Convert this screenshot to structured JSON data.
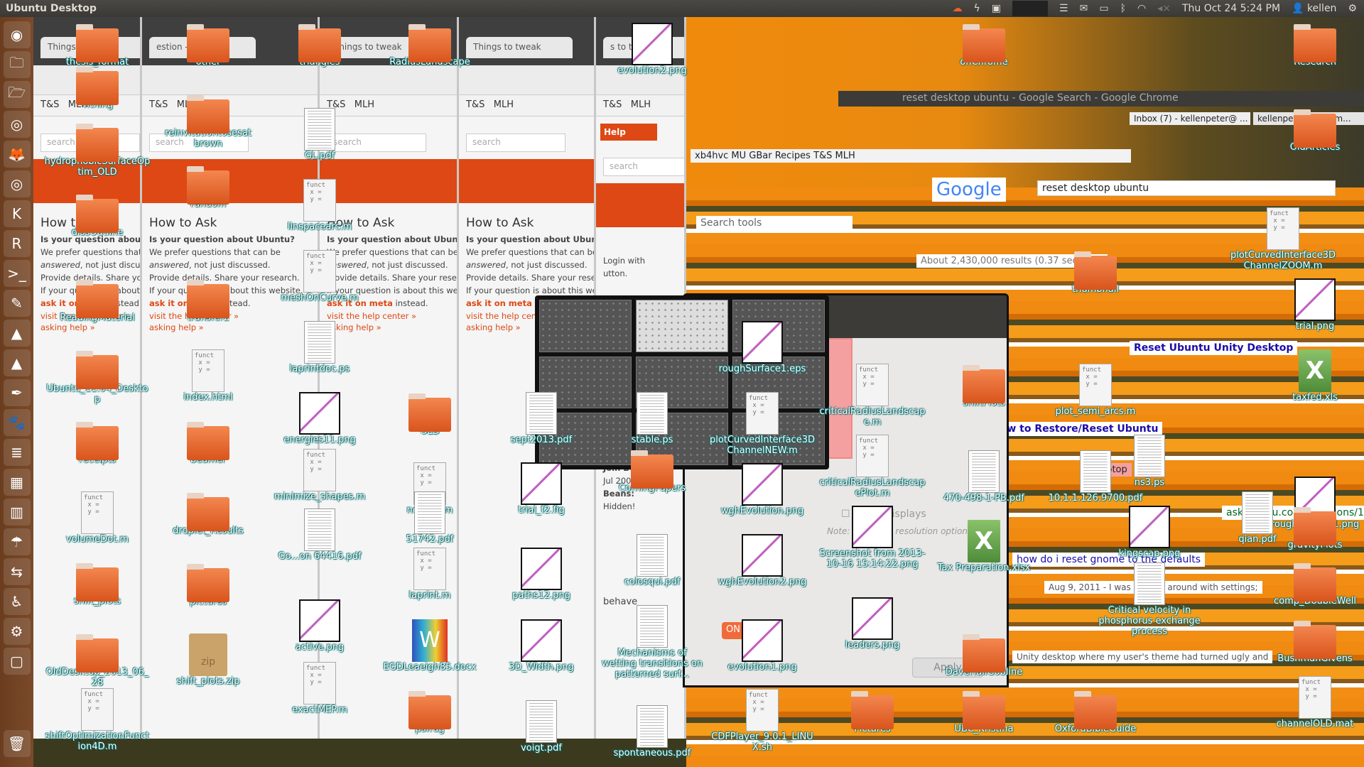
{
  "panel": {
    "title": "Ubuntu Desktop",
    "indicators": [
      "cloud-icon",
      "bolt-icon",
      "network-error-icon",
      "keyboard-menu-icon",
      "mail-icon",
      "battery-icon",
      "bluetooth-icon",
      "wifi-icon",
      "volume-muted-icon"
    ],
    "clock": "Thu Oct 24  5:24 PM",
    "user": "kellen",
    "power_icon": "gear-power-icon"
  },
  "launcher": {
    "items": [
      "ubuntu-dash-icon",
      "files-icon",
      "files-app-icon",
      "chrome-icon",
      "firefox-icon",
      "chromium-icon",
      "kde-icon",
      "jabref-icon",
      "terminal-icon",
      "text-editor-icon",
      "matlab-icon",
      "matlab-alt-icon",
      "inkscape-icon",
      "gimp-icon",
      "writer-icon",
      "calc-icon",
      "system-monitor-icon",
      "ubuntu-one-icon",
      "remote-desktop-icon",
      "accessibility-icon",
      "settings-icon",
      "workspace-switcher-icon",
      "trash-icon"
    ]
  },
  "browser": {
    "tabs": [
      "Things to tweak",
      "estion -",
      "Things to tweak",
      "Things to tweak",
      "s to twe"
    ],
    "bookmarks": [
      "T&S",
      "MLH"
    ],
    "search_placeholder": "search",
    "help_label": "Help",
    "help_link": "help",
    "heading": "How to Ask",
    "q1": "Is your question about Ubuntu?",
    "p1": "We prefer questions that can be",
    "p2a": "answered",
    "p2b": ", not just discussed.",
    "p3": "Provide details. Share your research.",
    "p4": "If your question is about this website,",
    "meta_link": "ask it on meta",
    "meta_tail": " instead.",
    "link_help": "visit the help center »",
    "link_asking": "asking help »",
    "login": "Login with",
    "button_tail": "utton.",
    "join": "Join Date",
    "join_val": "Jul 2009",
    "beans": "Beans:",
    "beans_val": "Hidden!",
    "behave": "behave"
  },
  "chrome": {
    "title": "reset desktop ubuntu - Google Search - Google Chrome",
    "tab_inbox": "Inbox (7) - kellenpeter@ ...",
    "tab_mail": "kellenpeterson@gm...",
    "bookmarks": "xb4hvc  MU  GBar  Recipes  T&S  MLH",
    "query": "reset desktop ubuntu",
    "search_tools": "Search tools",
    "results": "About 2,430,000 results (0.37 seconds)",
    "r1": "Reset Ubuntu Unity Desktop",
    "r2": "How to Restore/Reset Ubuntu",
    "r3": "askubuntu.com/questions/146",
    "r4": "how do i reset gnome to the defaults",
    "r5": "Aug 9, 2011 - I was playing around with settings;",
    "r6": "Unity desktop where my user's theme had turned ugly and",
    "laptop": "Laptop"
  },
  "settings_window": {
    "mirror": "Mirror displays",
    "note": "Note: may limit resolution options",
    "on": "ON",
    "apply": "Apply"
  },
  "desktop": {
    "icons": [
      {
        "label": "thesis_format",
        "type": "folder"
      },
      {
        "label": "Tithing",
        "type": "folder"
      },
      {
        "label": "hydrophobicSurfaceOptim_OLD",
        "type": "folder"
      },
      {
        "label": "dissOutline",
        "type": "folder"
      },
      {
        "label": "ReadingMaterial",
        "type": "folder"
      },
      {
        "label": "Ubuntu_11.04_Desktop",
        "type": "folder"
      },
      {
        "label": "receipts",
        "type": "folder"
      },
      {
        "label": "volumeDot.m",
        "type": "script"
      },
      {
        "label": "shift_plots",
        "type": "folder"
      },
      {
        "label": "OldDesktop_2013_06_28",
        "type": "folder"
      },
      {
        "label": "shiftOptimizationFunction4D.m",
        "type": "script"
      },
      {
        "label": "other",
        "type": "folder"
      },
      {
        "label": "reinvitationtosesat brown",
        "type": "folder"
      },
      {
        "label": "random",
        "type": "folder"
      },
      {
        "label": "transfer2",
        "type": "folder"
      },
      {
        "label": "index.html",
        "type": "script"
      },
      {
        "label": "beamer",
        "type": "folder"
      },
      {
        "label": "droplet_Results",
        "type": "folder"
      },
      {
        "label": "pictures",
        "type": "folder"
      },
      {
        "label": "shift_plots.zip",
        "type": "zip"
      },
      {
        "label": "triangles",
        "type": "folder"
      },
      {
        "label": "GL.pdf",
        "type": "pdf"
      },
      {
        "label": "linspacearc.m",
        "type": "script"
      },
      {
        "label": "meshOnCurve.m",
        "type": "script"
      },
      {
        "label": "laprintdoc.ps",
        "type": "pdf"
      },
      {
        "label": "energies11.png",
        "type": "image"
      },
      {
        "label": "minimize_shapes.m",
        "type": "script"
      },
      {
        "label": "Go...on 64416.pdf",
        "type": "pdf"
      },
      {
        "label": "active.png",
        "type": "image"
      },
      {
        "label": "exactMEP.m",
        "type": "script"
      },
      {
        "label": "RadiusLandscape",
        "type": "folder"
      },
      {
        "label": "OLD",
        "type": "folder"
      },
      {
        "label": "newton.m",
        "type": "script"
      },
      {
        "label": "51742.pdf",
        "type": "pdf"
      },
      {
        "label": "laprint.m",
        "type": "script"
      },
      {
        "label": "EGDLeaeigh85.docx",
        "type": "word"
      },
      {
        "label": "psfrag",
        "type": "folder"
      },
      {
        "label": "evolution2.png",
        "type": "image"
      },
      {
        "label": "sept2013.pdf",
        "type": "pdf"
      },
      {
        "label": "trial_f2.fig",
        "type": "image"
      },
      {
        "label": "paths12.png",
        "type": "image"
      },
      {
        "label": "3D_Width.png",
        "type": "image"
      },
      {
        "label": "voigt.pdf",
        "type": "pdf"
      },
      {
        "label": "stable.ps",
        "type": "pdf"
      },
      {
        "label": "CorningPapers",
        "type": "folder"
      },
      {
        "label": "colosqui.pdf",
        "type": "pdf"
      },
      {
        "label": "Mechanisms of wetting transitions on patterned surf...",
        "type": "pdf"
      },
      {
        "label": "spontaneous.pdf",
        "type": "pdf"
      },
      {
        "label": "roughSurface1.eps",
        "type": "image"
      },
      {
        "label": "plotCurvedInterface3DChannelNEW.m",
        "type": "script"
      },
      {
        "label": "wghEvolution.png",
        "type": "image"
      },
      {
        "label": "wghEvolution2.png",
        "type": "image"
      },
      {
        "label": "evolution1.png",
        "type": "image"
      },
      {
        "label": "CDFPlayer_9.0.1_LINUX.sh",
        "type": "script"
      },
      {
        "label": "criticalRadiusLandscape.m",
        "type": "script"
      },
      {
        "label": "criticalRadiusLandscapePlot.m",
        "type": "script"
      },
      {
        "label": "Screenshot from 2013-10-16 15:14:22.png",
        "type": "image"
      },
      {
        "label": "leaders.png",
        "type": "image"
      },
      {
        "label": "Pictures",
        "type": "folder"
      },
      {
        "label": "onChrome",
        "type": "folder"
      },
      {
        "label": "shiftPlots",
        "type": "folder"
      },
      {
        "label": "470-498-1-PB.pdf",
        "type": "pdf"
      },
      {
        "label": "Tax Preparation.xlsx",
        "type": "xls"
      },
      {
        "label": "DaveHallGobline",
        "type": "folder"
      },
      {
        "label": "UBC_Kristina",
        "type": "folder"
      },
      {
        "label": "thumbnail",
        "type": "folder"
      },
      {
        "label": "plot_semi_arcs.m",
        "type": "script"
      },
      {
        "label": "ns3.ps",
        "type": "pdf"
      },
      {
        "label": "10.1.1.126.9700.pdf",
        "type": "pdf"
      },
      {
        "label": "kingscap.png",
        "type": "image"
      },
      {
        "label": "Critical velocity in phosphorus exchange process",
        "type": "pdf"
      },
      {
        "label": "OxfordBibleGuide",
        "type": "folder"
      },
      {
        "label": "Research",
        "type": "folder"
      },
      {
        "label": "OldArticles",
        "type": "folder"
      },
      {
        "label": "plotCurvedInterface3DChannelZOOM.m",
        "type": "script"
      },
      {
        "label": "trial.png",
        "type": "image"
      },
      {
        "label": "taxfed.xls",
        "type": "xls"
      },
      {
        "label": "roughSurface1.png",
        "type": "image"
      },
      {
        "label": "qian.pdf",
        "type": "pdf"
      },
      {
        "label": "gravityPlots",
        "type": "folder"
      },
      {
        "label": "comp_DoubleWell",
        "type": "folder"
      },
      {
        "label": "BushmanGivens",
        "type": "folder"
      },
      {
        "label": "channelOLD.mat",
        "type": "script"
      }
    ]
  }
}
